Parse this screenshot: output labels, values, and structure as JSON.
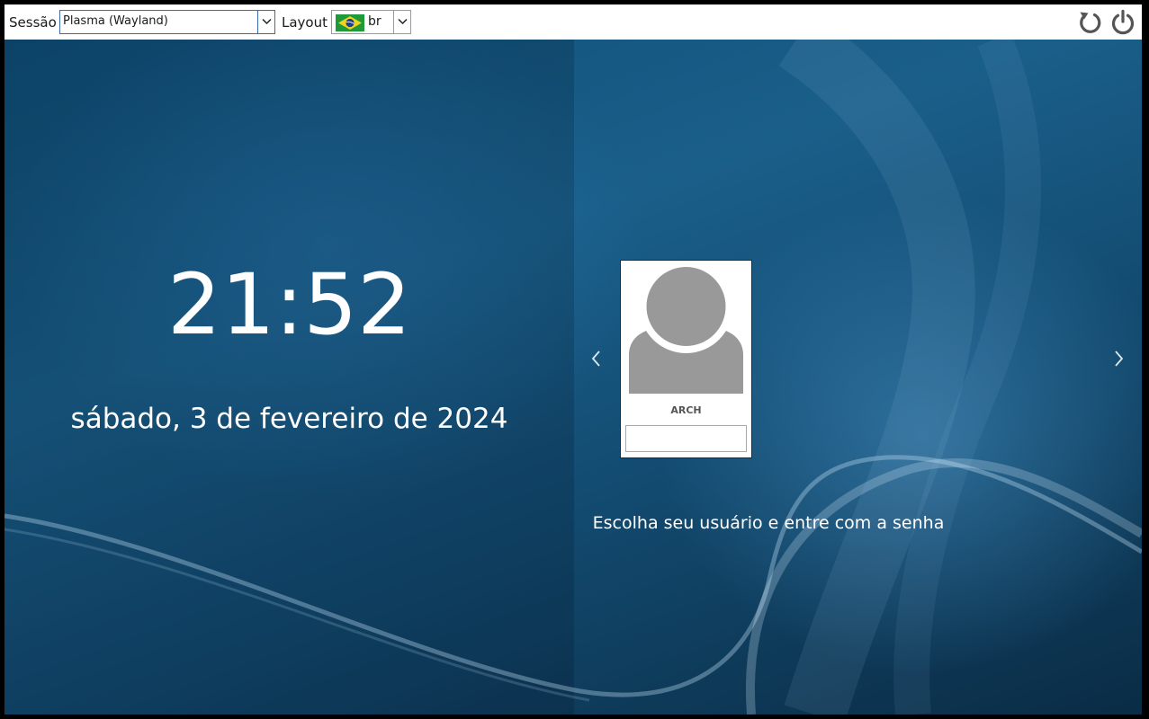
{
  "topbar": {
    "session_label": "Sessão",
    "session_value": "Plasma (Wayland)",
    "layout_label": "Layout",
    "layout_value": "br",
    "layout_flag": "brazil-flag-icon",
    "reboot_icon": "reboot-icon",
    "power_icon": "power-icon"
  },
  "clock": {
    "time": "21:52",
    "date": "sábado, 3 de fevereiro de 2024"
  },
  "user_selector": {
    "prev_icon": "chevron-left-icon",
    "next_icon": "chevron-right-icon",
    "users": [
      {
        "name": "ARCH",
        "avatar": "default-user-avatar",
        "password_value": ""
      }
    ],
    "prompt": "Escolha seu usuário e entre com a senha"
  },
  "colors": {
    "background": "#135a86",
    "accent_border": "#3d6aa8",
    "icon_gray": "#555555",
    "avatar_gray": "#999999"
  }
}
